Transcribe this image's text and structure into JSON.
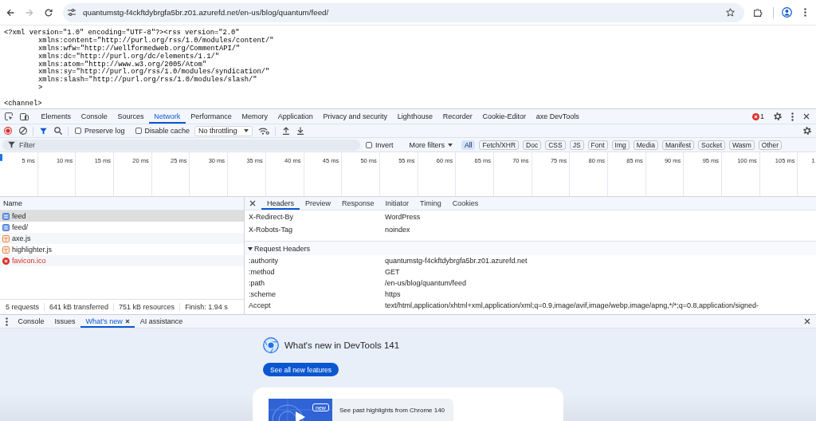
{
  "browser": {
    "url": "quantumstg-f4ckftdybrgfa5br.z01.azurefd.net/en-us/blog/quantum/feed/"
  },
  "document": {
    "blocks": [
      [
        "<?xml version=\"1.0\" encoding=\"UTF-8\"?><rss version=\"2.0\"",
        "xmlns:content=\"http://purl.org/rss/1.0/modules/content/\"",
        "xmlns:wfw=\"http://wellformedweb.org/CommentAPI/\"",
        "xmlns:dc=\"http://purl.org/dc/elements/1.1/\"",
        "xmlns:atom=\"http://www.w3.org/2005/Atom\"",
        "xmlns:sy=\"http://purl.org/rss/1.0/modules/syndication/\"",
        "xmlns:slash=\"http://purl.org/rss/1.0/modules/slash/\"",
        ">"
      ],
      [
        "<channel>"
      ]
    ]
  },
  "devtools": {
    "tabs": [
      {
        "label": "Elements",
        "selected": false
      },
      {
        "label": "Console",
        "selected": false
      },
      {
        "label": "Sources",
        "selected": false
      },
      {
        "label": "Network",
        "selected": true
      },
      {
        "label": "Performance",
        "selected": false
      },
      {
        "label": "Memory",
        "selected": false
      },
      {
        "label": "Application",
        "selected": false
      },
      {
        "label": "Privacy and security",
        "selected": false
      },
      {
        "label": "Lighthouse",
        "selected": false
      },
      {
        "label": "Recorder",
        "selected": false
      },
      {
        "label": "Cookie-Editor",
        "selected": false
      },
      {
        "label": "axe DevTools",
        "selected": false
      }
    ],
    "error_count": "1",
    "network": {
      "recording": true,
      "filter_active": true,
      "preserve_log": {
        "label": "Preserve log",
        "checked": false
      },
      "disable_cache": {
        "label": "Disable cache",
        "checked": false
      },
      "throttling": "No throttling",
      "filter": {
        "placeholder": "Filter"
      },
      "invert": {
        "label": "Invert",
        "checked": false
      },
      "more_filters": "More filters",
      "types": [
        {
          "label": "All",
          "selected": true
        },
        {
          "label": "Fetch/XHR",
          "selected": false
        },
        {
          "label": "Doc",
          "selected": false
        },
        {
          "label": "CSS",
          "selected": false
        },
        {
          "label": "JS",
          "selected": false
        },
        {
          "label": "Font",
          "selected": false
        },
        {
          "label": "Img",
          "selected": false
        },
        {
          "label": "Media",
          "selected": false
        },
        {
          "label": "Manifest",
          "selected": false
        },
        {
          "label": "Socket",
          "selected": false
        },
        {
          "label": "Wasm",
          "selected": false
        },
        {
          "label": "Other",
          "selected": false
        }
      ],
      "timeline_ticks": [
        "5 ms",
        "10 ms",
        "15 ms",
        "20 ms",
        "25 ms",
        "30 ms",
        "35 ms",
        "40 ms",
        "45 ms",
        "50 ms",
        "55 ms",
        "60 ms",
        "65 ms",
        "70 ms",
        "75 ms",
        "80 ms",
        "85 ms",
        "90 ms",
        "95 ms",
        "100 ms",
        "105 ms",
        "1"
      ],
      "requests": {
        "column": "Name",
        "rows": [
          {
            "name": "feed",
            "kind": "document",
            "selected": true
          },
          {
            "name": "feed/",
            "kind": "document",
            "selected": false
          },
          {
            "name": "axe.js",
            "kind": "script",
            "selected": false
          },
          {
            "name": "highlighter.js",
            "kind": "script",
            "selected": false
          },
          {
            "name": "favicon.ico",
            "kind": "error",
            "selected": false
          }
        ]
      },
      "summary": [
        "5 requests",
        "641 kB transferred",
        "751 kB resources",
        "Finish: 1.94 s"
      ],
      "details": {
        "tabs": [
          {
            "label": "Headers",
            "selected": true
          },
          {
            "label": "Preview",
            "selected": false
          },
          {
            "label": "Response",
            "selected": false
          },
          {
            "label": "Initiator",
            "selected": false
          },
          {
            "label": "Timing",
            "selected": false
          },
          {
            "label": "Cookies",
            "selected": false
          }
        ],
        "response_headers": [
          {
            "name": "X-Redirect-By",
            "value": "WordPress"
          },
          {
            "name": "X-Robots-Tag",
            "value": "noindex"
          }
        ],
        "request_headers": {
          "title": "Request Headers",
          "expanded": true,
          "rows": [
            {
              "name": ":authority",
              "value": "quantumstg-f4ckftdybrgfa5br.z01.azurefd.net"
            },
            {
              "name": ":method",
              "value": "GET"
            },
            {
              "name": ":path",
              "value": "/en-us/blog/quantum/feed"
            },
            {
              "name": ":scheme",
              "value": "https"
            },
            {
              "name": "Accept",
              "value": "text/html,application/xhtml+xml,application/xml;q=0.9,image/avif,image/webp,image/apng,*/*;q=0.8,application/signed-"
            }
          ]
        }
      }
    },
    "drawer": {
      "tabs": [
        {
          "label": "Console",
          "selected": false,
          "closable": false
        },
        {
          "label": "Issues",
          "selected": false,
          "closable": false
        },
        {
          "label": "What's new",
          "selected": true,
          "closable": true
        },
        {
          "label": "AI assistance",
          "selected": false,
          "closable": false
        }
      ],
      "whats_new": {
        "title": "What's new in DevTools 141",
        "button": "See all new features",
        "highlight": {
          "badge": "new",
          "text": "See past highlights from Chrome 140"
        }
      }
    }
  }
}
